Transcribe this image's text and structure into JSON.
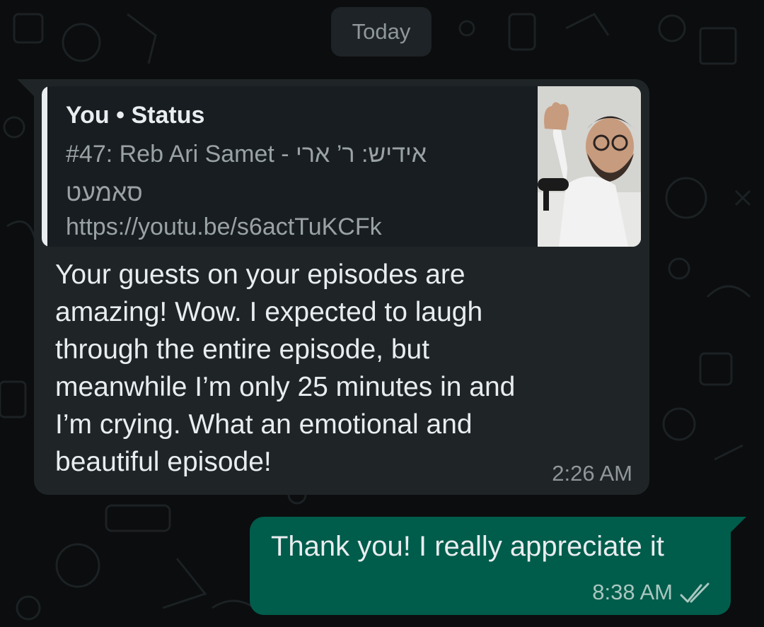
{
  "chat": {
    "date_label": "Today",
    "incoming": {
      "quote": {
        "author": "You • Status",
        "line1": "#47: Reb Ari Samet - אידיש: ר’ ארי",
        "line2": "סאמעט",
        "line3": "https://youtu.be/s6actTuKCFk",
        "thumbnail_icon": "video-thumbnail-icon"
      },
      "text": "Your guests on your episodes are\namazing! Wow. I expected to laugh\nthrough the entire episode, but\nmeanwhile I’m only 25 minutes in and\nI’m crying. What an emotional and\nbeautiful episode!",
      "time": "2:26 AM"
    },
    "outgoing": {
      "text": "Thank you! I really appreciate it",
      "time": "8:38 AM",
      "status_icon": "double-check-icon"
    }
  },
  "colors": {
    "background": "#0b0d0e",
    "incoming_bubble": "#1f2527",
    "outgoing_bubble": "#005c4b",
    "text": "#e9edef",
    "muted_text": "#8f979b"
  }
}
